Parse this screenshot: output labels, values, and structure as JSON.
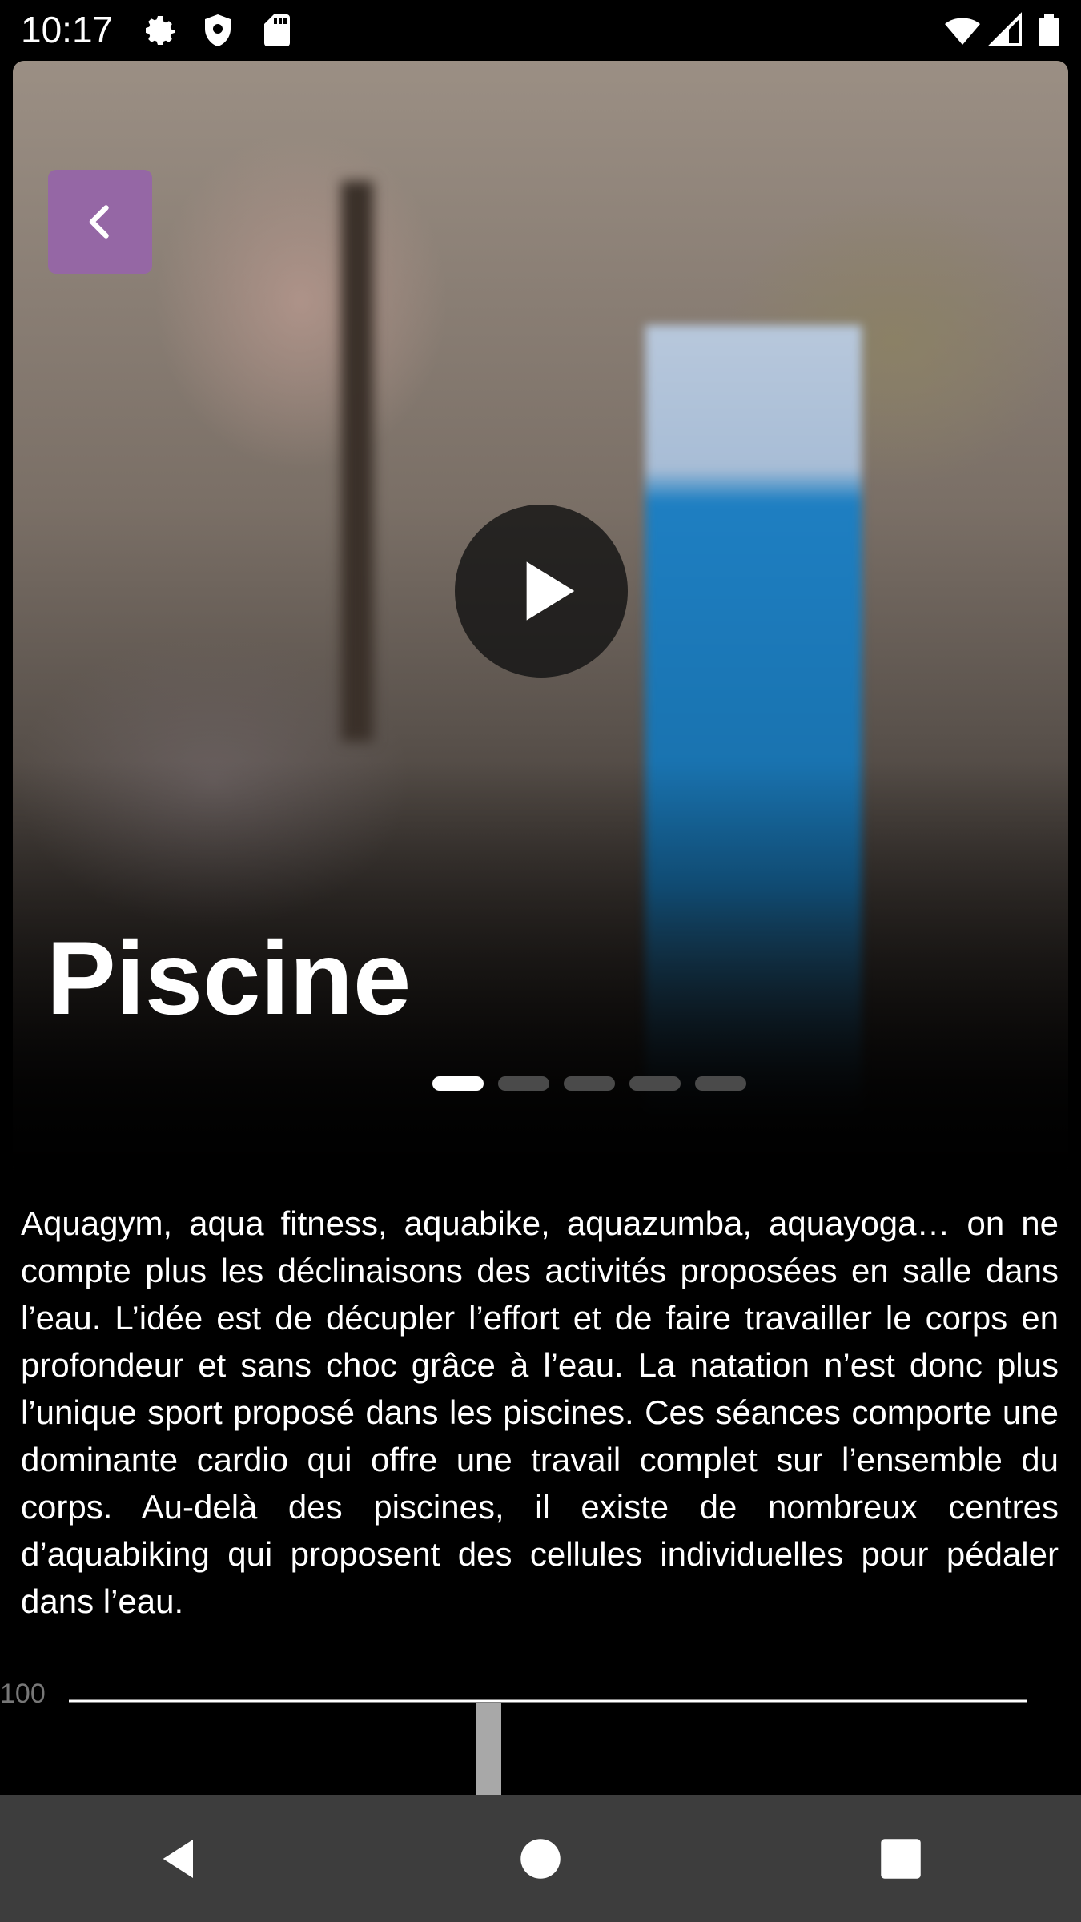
{
  "status_bar": {
    "time": "10:17",
    "icons": [
      "gear-icon",
      "shield-icon",
      "sd-card-icon",
      "wifi-icon",
      "signal-icon",
      "battery-icon"
    ]
  },
  "hero": {
    "title": "Piscine",
    "back_icon": "chevron-left-icon",
    "play_icon": "play-icon",
    "carousel": {
      "count": 5,
      "active_index": 0
    },
    "accent_color": "#9664aa"
  },
  "description": "Aquagym, aqua fitness, aquabike, aquazumba, aquayoga… on ne compte plus les déclinaisons des activités proposées en salle dans l’eau. L’idée est de décupler l’effort et de faire travailler le corps en profondeur et sans choc grâce à l’eau. La natation n’est donc plus l’unique sport proposé dans les piscines. Ces séances comporte une dominante cardio qui offre une travail complet sur l’ensemble du corps. Au-delà des piscines, il existe de nombreux centres d’aquabiking qui proposent des cellules individuelles pour pédaler dans l’eau.",
  "chart": {
    "tick_label": "100"
  },
  "nav_bar": {
    "back": "back-triangle-icon",
    "home": "home-circle-icon",
    "recents": "recents-square-icon"
  }
}
